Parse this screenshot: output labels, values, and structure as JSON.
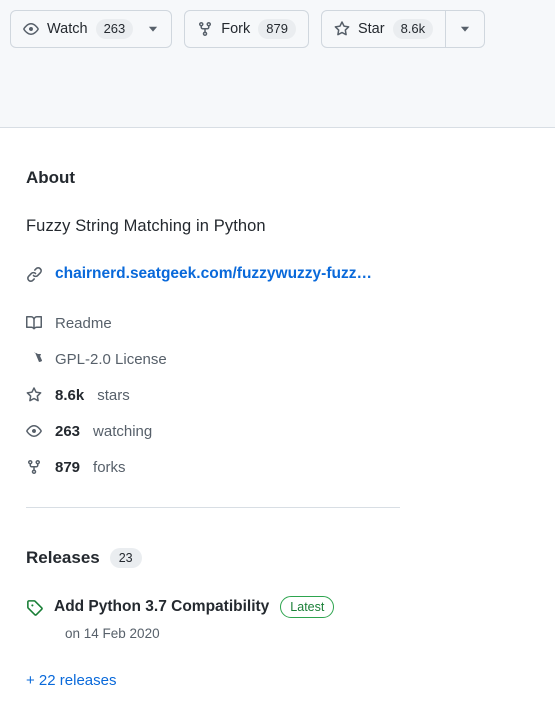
{
  "action_bar": {
    "watch": {
      "icon": "eye-icon",
      "label": "Watch",
      "count": "263",
      "dropdown_icon": "chevron-down-icon"
    },
    "fork": {
      "icon": "repo-forked-icon",
      "label": "Fork",
      "count": "879"
    },
    "star": {
      "icon": "star-icon",
      "label": "Star",
      "count": "8.6k",
      "dropdown_icon": "chevron-down-icon"
    }
  },
  "about": {
    "title": "About",
    "description": "Fuzzy String Matching in Python",
    "homepage": {
      "icon": "link-icon",
      "url_text": "chairnerd.seatgeek.com/fuzzywuzzy-fuzz…"
    },
    "meta": [
      {
        "icon": "book-icon",
        "value": "",
        "label": "Readme"
      },
      {
        "icon": "law-icon",
        "value": "",
        "label": "GPL-2.0 License"
      },
      {
        "icon": "star-icon",
        "value": "8.6k",
        "label": "stars"
      },
      {
        "icon": "eye-icon",
        "value": "263",
        "label": "watching"
      },
      {
        "icon": "repo-forked-icon",
        "value": "879",
        "label": "forks"
      }
    ]
  },
  "releases": {
    "title": "Releases",
    "count": "23",
    "latest": {
      "icon": "tag-icon",
      "name": "Add Python 3.7 Compatibility",
      "badge": "Latest",
      "date": "on 14 Feb 2020"
    },
    "more_link": "+ 22 releases"
  },
  "colors": {
    "link": "#0969da",
    "green": "#2da44e",
    "muted": "#57606a",
    "header_bg": "#f6f8fa",
    "border": "#d0d7de"
  }
}
